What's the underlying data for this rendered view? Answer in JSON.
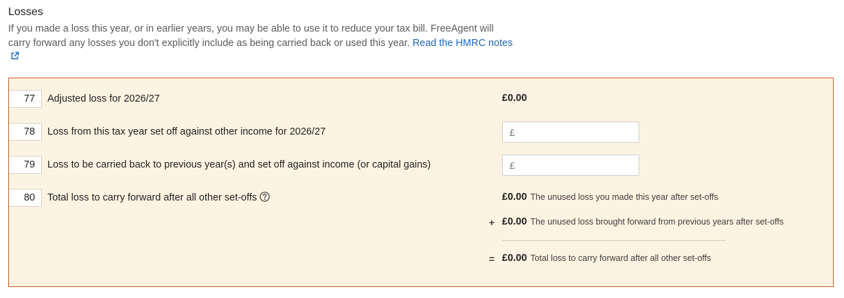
{
  "section": {
    "title": "Losses",
    "intro_text": "If you made a loss this year, or in earlier years, you may be able to use it to reduce your tax bill. FreeAgent will carry forward any losses you don't explicitly include as being carried back or used this year.",
    "link_text": "Read the HMRC notes"
  },
  "rows": [
    {
      "box": "77",
      "label": "Adjusted loss for 2026/27",
      "value": "£0.00"
    },
    {
      "box": "78",
      "label": "Loss from this tax year set off against other income for 2026/27",
      "placeholder": "£"
    },
    {
      "box": "79",
      "label": "Loss to be carried back to previous year(s) and set off against income (or capital gains)",
      "placeholder": "£"
    },
    {
      "box": "80",
      "label": "Total loss to carry forward after all other set-offs"
    }
  ],
  "carry_forward": {
    "this_year": {
      "amount": "£0.00",
      "note": "The unused loss you made this year after set-offs"
    },
    "previous_years": {
      "operator": "+",
      "amount": "£0.00",
      "note": "The unused loss brought forward from previous years after set-offs"
    },
    "total": {
      "operator": "=",
      "amount": "£0.00",
      "note": "Total loss to carry forward after all other set-offs"
    }
  },
  "colors": {
    "panel_background": "#fdf3e2",
    "panel_border": "#c45f21",
    "link": "#1f64b8"
  },
  "icons": {
    "external_link": "external-link-icon",
    "help": "question-circle-icon"
  }
}
